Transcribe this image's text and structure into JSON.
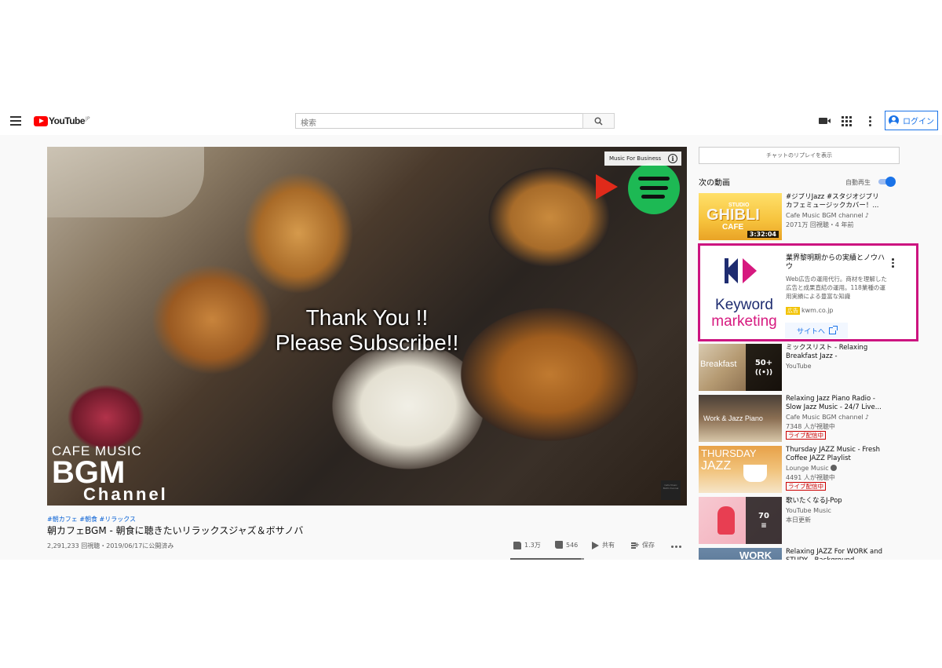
{
  "header": {
    "logo_text": "YouTube",
    "logo_region": "JP",
    "search_placeholder": "検索",
    "login_label": "ログイン"
  },
  "player": {
    "overlay_line1": "Thank You !!",
    "overlay_line2": "Please Subscribe!!",
    "card_label": "Music For Business",
    "brand_line1": "CAFE MUSIC",
    "brand_line2": "BGM",
    "brand_line3": "Channel",
    "watermark": "Cafe Music BGM channel"
  },
  "video": {
    "hashtags": "#朝カフェ #朝食 #リラックス",
    "title": "朝カフェBGM - 朝食に聴きたいリラックスジャズ＆ボサノバ",
    "views": "2,291,233 回視聴・2019/06/17に公開済み",
    "likes": "1.3万",
    "dislikes": "546",
    "share_label": "共有",
    "save_label": "保存",
    "like_ratio": 0.96
  },
  "sidebar": {
    "chat_replay": "チャットのリプレイを表示",
    "up_next": "次の動画",
    "autoplay": "自動再生",
    "autoplay_on": true,
    "items": [
      {
        "title": "#ジブリJazz #スタジオジブリ カフェミュージックカバー！...",
        "channel": "Cafe Music BGM channel",
        "meta": "2071万 回視聴・4 年前",
        "duration": "3:32:04",
        "thumb_line1": "STUDIO",
        "thumb_line2": "GHIBLI",
        "thumb_line3": "CAFE"
      },
      {
        "title": "ミックスリスト - Relaxing Breakfast Jazz - Background...",
        "channel": "YouTube",
        "overlay_count": "50+",
        "thumb_text": "Breakfast"
      },
      {
        "title": "Relaxing Jazz Piano Radio - Slow Jazz Music - 24/7 Live...",
        "channel": "Cafe Music BGM channel",
        "meta": "7348 人が視聴中",
        "badge": "ライブ配信中",
        "thumb_text": "Work & Jazz Piano"
      },
      {
        "title": "Thursday JAZZ Music - Fresh Coffee JAZZ Playlist",
        "channel": "Lounge Music",
        "meta": "4491 人が視聴中",
        "badge": "ライブ配信中",
        "thumb_line1": "THURSDAY",
        "thumb_line2": "JAZZ"
      },
      {
        "title": "歌いたくなるJ-Pop",
        "channel": "YouTube Music",
        "meta": "本日更新",
        "overlay_count": "70"
      },
      {
        "title": "Relaxing JAZZ For WORK and STUDY - Background...",
        "thumb_text": "WORK"
      }
    ],
    "ad": {
      "logo_line1": "Keyword",
      "logo_line2": "marketing",
      "title": "業界黎明期からの実績とノウハウ",
      "description": "Web広告の運用代行。商材を理解した広告と成果直結の運用。118業種の運用実績による豊富な知識",
      "badge": "広告",
      "domain": "kwm.co.jp",
      "cta": "サイトへ",
      "highlight_color": "#cc1480"
    }
  }
}
